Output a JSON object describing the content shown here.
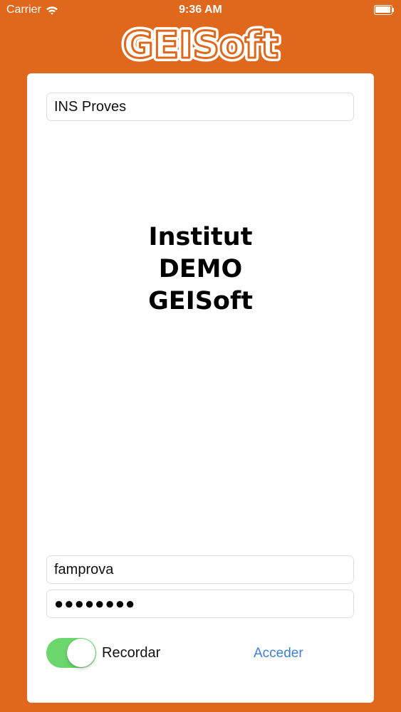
{
  "status_bar": {
    "carrier": "Carrier",
    "time": "9:36 AM",
    "wifi_icon": "wifi-icon",
    "battery_icon": "battery-icon"
  },
  "logo": {
    "text": "GEISoft"
  },
  "school_field": {
    "value": "INS Proves"
  },
  "institution": {
    "line1": "Institut",
    "line2": "DEMO",
    "line3": "GEISoft"
  },
  "username_field": {
    "value": "famprova"
  },
  "password_field": {
    "value": "●●●●●●●●"
  },
  "remember": {
    "label": "Recordar",
    "enabled": true
  },
  "submit": {
    "label": "Acceder"
  },
  "colors": {
    "background": "#E0681C",
    "card": "#FFFFFF",
    "toggle_on": "#6BD66B",
    "link": "#3F7FD6"
  }
}
